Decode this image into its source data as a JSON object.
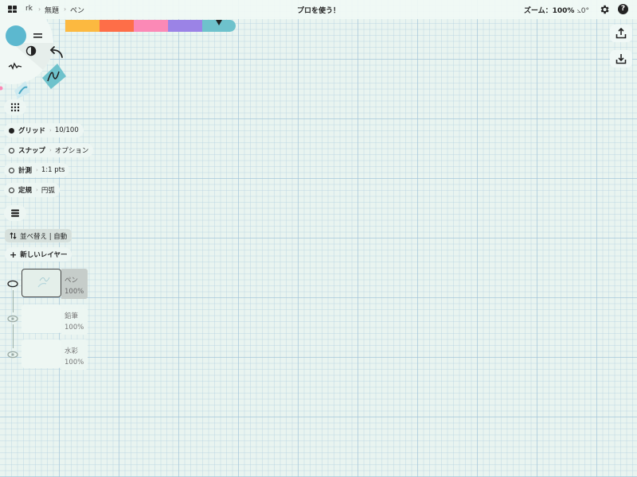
{
  "topbar": {
    "breadcrumb": [
      "rk",
      "無題",
      "ペン"
    ],
    "separator": "›",
    "promo": "プロを使う！",
    "zoom_label": "ズーム：100%",
    "rotation": "0°",
    "icons": [
      "apps-grid-icon",
      "gear-icon",
      "help-icon"
    ]
  },
  "palette": {
    "colors": [
      "#fcb940",
      "#fe6e48",
      "#fb89b6",
      "#9b83e6",
      "#6ec2cc"
    ],
    "selected_index": 4
  },
  "brush_wheel": {
    "current_color": "#5cb8cf",
    "icons": [
      "color-well-icon",
      "menu-lines-icon",
      "contrast-icon",
      "undo-icon",
      "brush-stroke-icon",
      "pen-tool-icon"
    ]
  },
  "right_toolbar": {
    "icons": [
      "share-upload-icon",
      "import-download-icon"
    ]
  },
  "guides": {
    "items": [
      {
        "label": "グリッド",
        "value": "10/100",
        "enabled": true
      },
      {
        "label": "スナップ",
        "value": "オプション",
        "enabled": false
      },
      {
        "label": "計測",
        "value": "1:1 pts",
        "enabled": false
      },
      {
        "label": "定規",
        "value": "円弧",
        "enabled": false
      }
    ]
  },
  "layers_panel": {
    "sort_label": "並べ替え | 自動",
    "new_layer_label": "新しいレイヤー",
    "layers": [
      {
        "name": "ペン",
        "opacity": "100%",
        "active": true
      },
      {
        "name": "鉛筆",
        "opacity": "100%",
        "active": false
      },
      {
        "name": "水彩",
        "opacity": "100%",
        "active": false
      }
    ]
  }
}
